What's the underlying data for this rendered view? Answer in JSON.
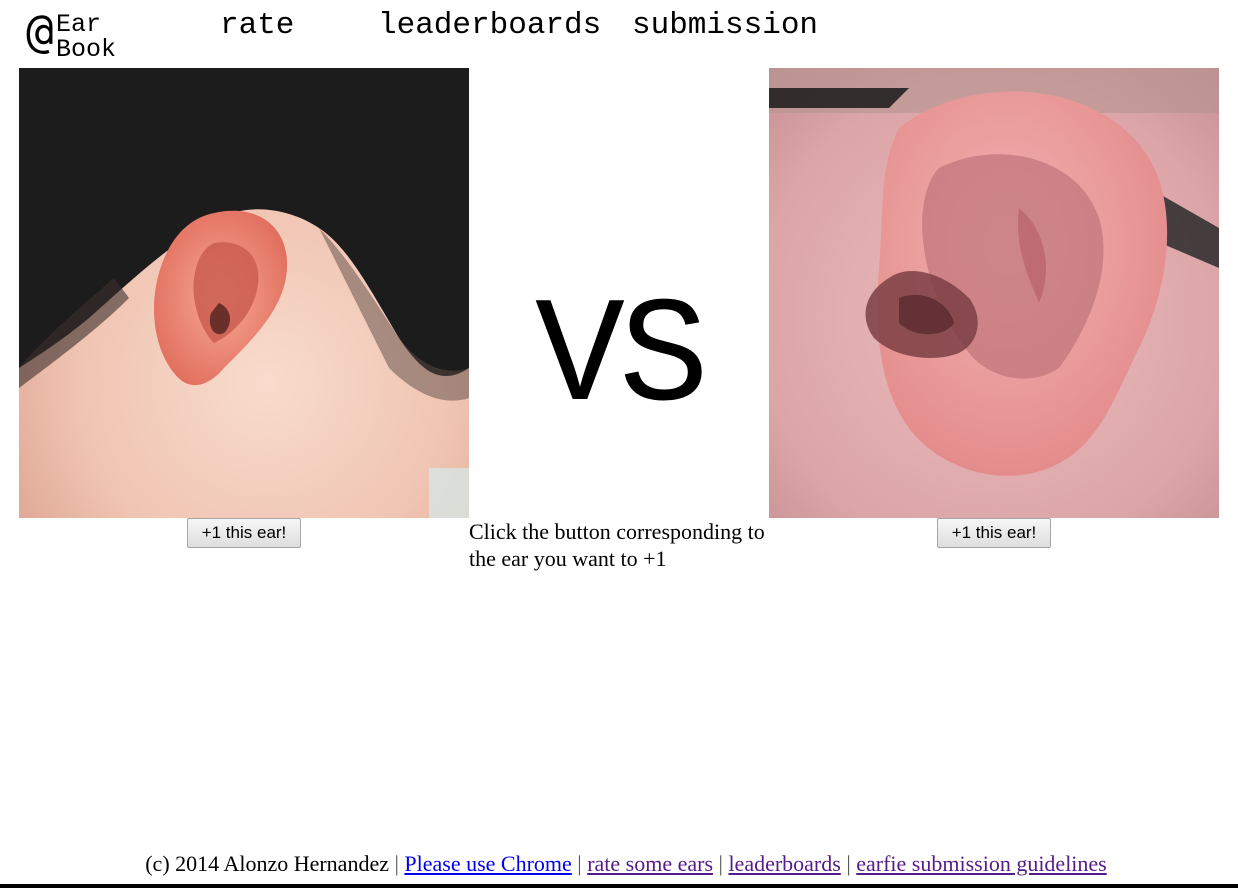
{
  "logo": {
    "at_symbol": "@",
    "line1": "Ear",
    "line2": "Book"
  },
  "nav": {
    "rate": "rate",
    "leaderboards": "leaderboards",
    "submission": "submission"
  },
  "vs_text": "VS",
  "buttons": {
    "left_label": "+1 this ear!",
    "right_label": "+1 this ear!"
  },
  "instructions": "Click the button corresponding to the ear you want to +1",
  "footer": {
    "copyright": "(c) 2014 Alonzo Hernandez",
    "separator": "|",
    "link_chrome": "Please use Chrome",
    "link_rate": "rate some ears",
    "link_leaderboards": "leaderboards",
    "link_guidelines": "earfie submission guidelines"
  },
  "colors": {
    "link_unvisited": "#0000ee",
    "link_visited": "#551a8b",
    "skin_left": "#f0c4b2",
    "hair_left": "#1c1c1c",
    "skin_right": "#e3a9a9"
  }
}
